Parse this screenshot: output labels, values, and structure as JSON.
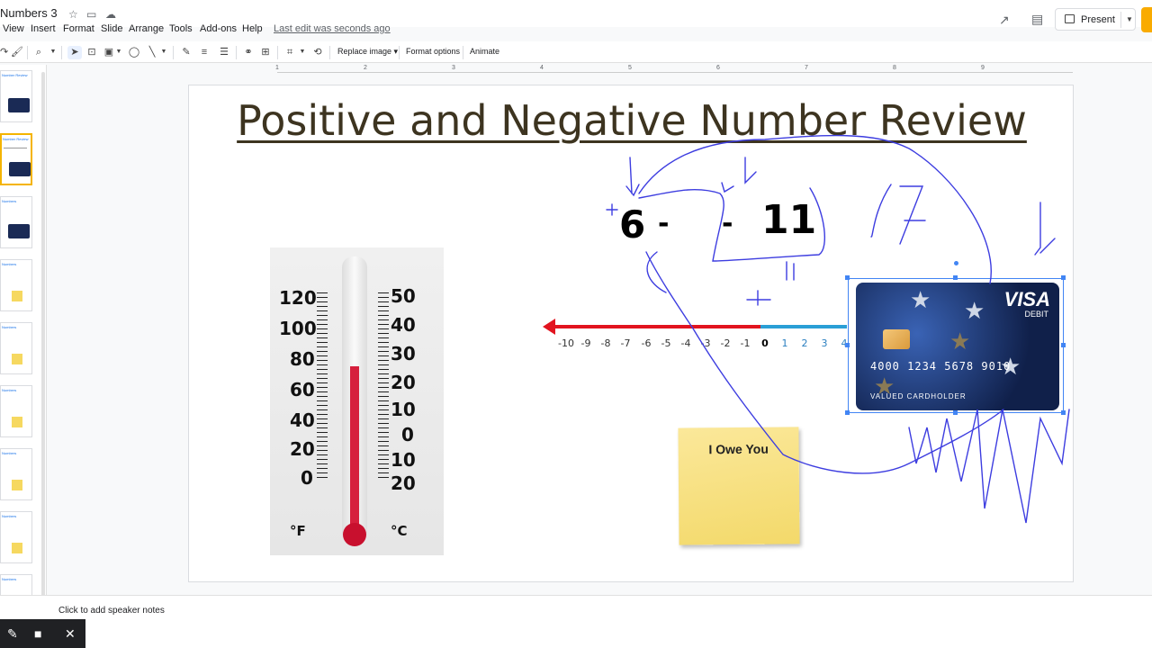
{
  "doc": {
    "title": "Numbers 3"
  },
  "menu": [
    "View",
    "Insert",
    "Format",
    "Slide",
    "Arrange",
    "Tools",
    "Add-ons",
    "Help"
  ],
  "last_edit": "Last edit was seconds ago",
  "present_label": "Present",
  "toolbar": {
    "replace_image": "Replace image",
    "format_options": "Format options",
    "animate": "Animate"
  },
  "ruler_ticks": [
    "1",
    "2",
    "3",
    "4",
    "5",
    "6",
    "7",
    "8",
    "9"
  ],
  "slide": {
    "title": "Positive and Negative Number Review",
    "thermometer": {
      "f_labels": [
        "120",
        "100",
        "80",
        "60",
        "40",
        "20",
        "0"
      ],
      "c_labels": [
        "50",
        "40",
        "30",
        "20",
        "10",
        "0",
        "10",
        "20"
      ],
      "f_unit": "°F",
      "c_unit": "°C"
    },
    "equation": {
      "left": "6",
      "op1": "-",
      "op2": "-",
      "right": "11"
    },
    "number_line": [
      "-10",
      "-9",
      "-8",
      "-7",
      "-6",
      "-5",
      "-4",
      "-3",
      "-2",
      "-1",
      "0",
      "1",
      "2",
      "3",
      "4"
    ],
    "sticky_note": "I Owe You",
    "card": {
      "brand": "VISA",
      "type": "DEBIT",
      "number": "4000 1234 5678 9010",
      "holder": "VALUED CARDHOLDER"
    }
  },
  "speaker_notes_placeholder": "Click to add speaker notes",
  "colors": {
    "accent": "#f4b400",
    "selection": "#4285f4",
    "ink": "#3d3de0"
  }
}
